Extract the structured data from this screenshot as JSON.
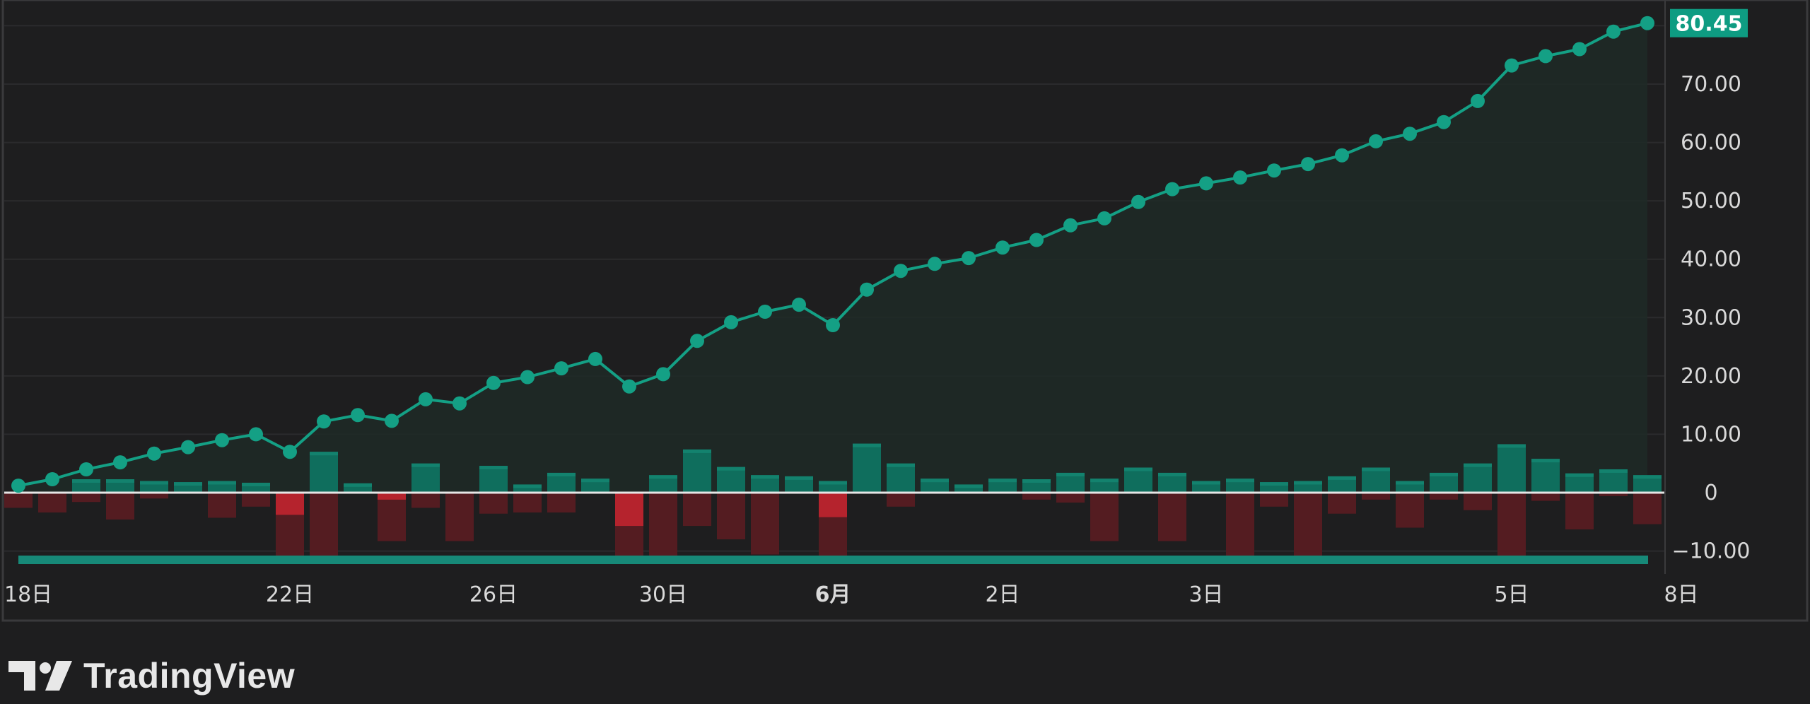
{
  "colors": {
    "background": "#1e1e1f",
    "grid": "#2b2b2d",
    "frame": "#3a3a3c",
    "line": "#14a085",
    "area": "#1f2a27",
    "bar_pos": "#0f6e5d",
    "bar_pos_light": "#13826e",
    "bar_neg": "#b5232d",
    "bar_neg_dark": "#541c21",
    "zero_line": "#e6e6e6",
    "baseline_band": "#178978",
    "label_bg": "#0e9c82",
    "axis_text": "#d9d9d9"
  },
  "brand": {
    "name": "TradingView",
    "icon": "tradingview-logo-icon"
  },
  "chart_data": {
    "type": "line",
    "title": "",
    "xlabel": "",
    "ylabel": "",
    "ylim": [
      -13,
      82
    ],
    "grid": true,
    "legend": "none",
    "last_value_label": "80.45",
    "y_ticks": [
      {
        "value": 70,
        "label": "70.00"
      },
      {
        "value": 60,
        "label": "60.00"
      },
      {
        "value": 50,
        "label": "50.00"
      },
      {
        "value": 40,
        "label": "40.00"
      },
      {
        "value": 30,
        "label": "30.00"
      },
      {
        "value": 20,
        "label": "20.00"
      },
      {
        "value": 10,
        "label": "10.00"
      },
      {
        "value": 0,
        "label": "0"
      },
      {
        "value": -10,
        "label": "−10.00"
      }
    ],
    "x_ticks": [
      {
        "index": 0,
        "label": "18日",
        "bold": false
      },
      {
        "index": 8,
        "label": "22日",
        "bold": false
      },
      {
        "index": 14,
        "label": "26日",
        "bold": false
      },
      {
        "index": 19,
        "label": "30日",
        "bold": false
      },
      {
        "index": 24,
        "label": "6月",
        "bold": true
      },
      {
        "index": 29,
        "label": "2日",
        "bold": false
      },
      {
        "index": 35,
        "label": "3日",
        "bold": false
      },
      {
        "index": 44,
        "label": "5日",
        "bold": false
      },
      {
        "index": 49,
        "label": "8日",
        "bold": false
      }
    ],
    "series": [
      {
        "kind": "line",
        "values": [
          1.2,
          2.3,
          4.0,
          5.2,
          6.7,
          7.8,
          9.0,
          10.0,
          7.0,
          12.2,
          13.3,
          12.3,
          16.0,
          15.3,
          18.8,
          19.8,
          21.3,
          22.9,
          18.2,
          20.3,
          26.0,
          29.2,
          31.0,
          32.2,
          28.7,
          34.8,
          38.0,
          39.2,
          40.2,
          42.0,
          43.3,
          45.8,
          47.0,
          49.8,
          52.0,
          53.0,
          54.0,
          55.2,
          56.3,
          57.8,
          60.2,
          61.5,
          63.5,
          67.1,
          73.2,
          74.8,
          76.0,
          79.0,
          80.45
        ]
      },
      {
        "kind": "bar_positive",
        "values": [
          0,
          0,
          2.3,
          2.3,
          2.0,
          1.8,
          2.0,
          1.7,
          0,
          7.0,
          1.6,
          0,
          5.0,
          0,
          4.6,
          1.4,
          3.4,
          2.4,
          0,
          3.0,
          7.4,
          4.4,
          3.0,
          2.8,
          2.0,
          8.4,
          5.0,
          2.4,
          1.4,
          2.4,
          2.3,
          3.4,
          2.4,
          4.3,
          3.4,
          2.0,
          2.4,
          1.8,
          2.0,
          2.8,
          4.3,
          2.0,
          3.4,
          5.0,
          8.3,
          5.8,
          3.3,
          4.0,
          3.0
        ]
      },
      {
        "kind": "bar_negative",
        "values": [
          -2.6,
          -3.4,
          -1.6,
          -4.6,
          -1.0,
          0,
          -4.3,
          -2.4,
          -12.0,
          -12.0,
          0,
          -8.3,
          -2.6,
          -8.3,
          -3.6,
          -3.4,
          -3.4,
          0,
          -12.0,
          -12.0,
          -5.7,
          -8.0,
          -10.6,
          0,
          -12.0,
          0,
          -2.4,
          0,
          0,
          0,
          -1.2,
          -1.7,
          -8.3,
          0,
          -8.3,
          0,
          -12.0,
          -2.4,
          -12.0,
          -3.6,
          -1.2,
          -6.0,
          -1.2,
          -3.0,
          -12.0,
          -1.4,
          -6.3,
          -0.6,
          -5.4
        ]
      },
      {
        "kind": "bar_negative_highlight",
        "values": [
          0,
          0,
          0,
          0,
          0,
          0,
          0,
          0,
          -3.8,
          0,
          0,
          -1.2,
          0,
          0,
          0,
          0,
          0,
          0,
          -5.7,
          0,
          0,
          0,
          0,
          0,
          -4.2,
          0,
          0,
          0,
          0,
          0,
          0,
          0,
          0,
          0,
          0,
          0,
          0,
          0,
          0,
          0,
          0,
          0,
          0,
          0,
          0,
          0,
          0,
          0,
          0
        ]
      }
    ]
  }
}
